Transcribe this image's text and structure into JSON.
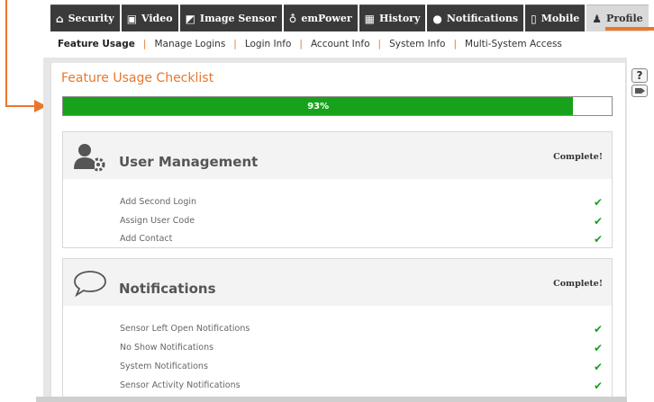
{
  "tabs": [
    {
      "label": "Security",
      "icon": "home-icon",
      "glyph": "⌂"
    },
    {
      "label": "Video",
      "icon": "video-icon",
      "glyph": "▣"
    },
    {
      "label": "Image Sensor",
      "icon": "image-sensor-icon",
      "glyph": "◩"
    },
    {
      "label": "emPower",
      "icon": "bulb-icon",
      "glyph": "♁"
    },
    {
      "label": "History",
      "icon": "calendar-icon",
      "glyph": "▦"
    },
    {
      "label": "Notifications",
      "icon": "chat-bubble-icon",
      "glyph": "●"
    },
    {
      "label": "Mobile",
      "icon": "mobile-icon",
      "glyph": "▯"
    },
    {
      "label": "Profile",
      "icon": "person-icon",
      "glyph": "♟"
    }
  ],
  "active_tab": "Profile",
  "subnav": {
    "items": [
      "Feature Usage",
      "Manage Logins",
      "Login Info",
      "Account Info",
      "System Info",
      "Multi-System Access"
    ],
    "active": "Feature Usage",
    "separator": "|"
  },
  "panel": {
    "title": "Feature Usage Checklist",
    "help_label": "?",
    "help_icon": "question-icon",
    "video_icon": "video-camera-icon"
  },
  "progress": {
    "percent": 93,
    "label": "93%",
    "fill_color": "#18a21b"
  },
  "sections": [
    {
      "title": "User Management",
      "status": "Complete!",
      "icon": "user-gear-icon",
      "items": [
        {
          "label": "Add Second Login",
          "done": true
        },
        {
          "label": "Assign User Code",
          "done": true
        },
        {
          "label": "Add Contact",
          "done": true
        }
      ]
    },
    {
      "title": "Notifications",
      "status": "Complete!",
      "icon": "speech-bubble-icon",
      "items": [
        {
          "label": "Sensor Left Open Notifications",
          "done": true
        },
        {
          "label": "No Show Notifications",
          "done": true
        },
        {
          "label": "System Notifications",
          "done": true
        },
        {
          "label": "Sensor Activity Notifications",
          "done": true
        }
      ]
    }
  ],
  "check_glyph": "✔",
  "colors": {
    "accent": "#e8772e",
    "tab_bg": "#3a3a3a",
    "check": "#1aa01f"
  }
}
